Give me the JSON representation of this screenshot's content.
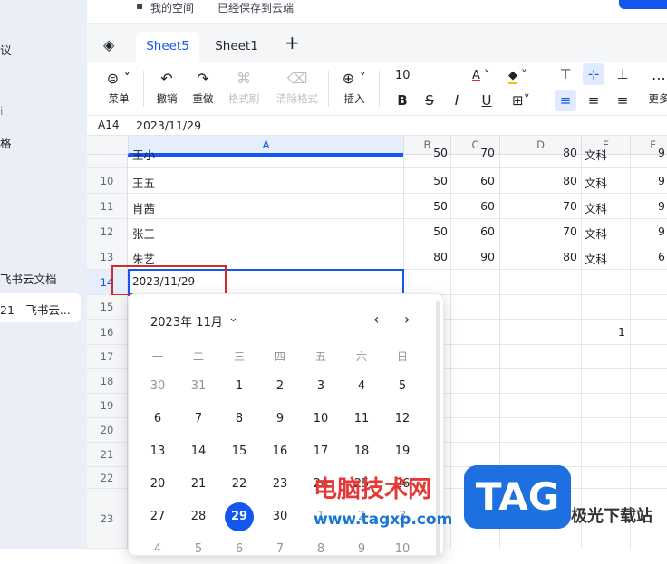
{
  "sidebar": {
    "items": [
      "议",
      "格",
      "飞书云文档",
      "21 - 飞书云..."
    ]
  },
  "topbar": {
    "space": "我的空间",
    "save_status": "已经保存到云端"
  },
  "tabs": [
    "Sheet5",
    "Sheet1"
  ],
  "add_sheet": "+",
  "toolbar": {
    "menu": "菜单",
    "undo": "撤销",
    "redo": "重做",
    "format_painter": "格式刷",
    "clear_format": "清除格式",
    "insert": "插入",
    "font_size": "10",
    "more": "更多"
  },
  "formula_bar": {
    "cell_ref": "A14",
    "value": "2023/11/29"
  },
  "columns": [
    "A",
    "B",
    "C",
    "D",
    "E",
    "F"
  ],
  "rows": [
    {
      "n": "10",
      "a": "王五",
      "b": "50",
      "c": "60",
      "d": "80",
      "e": "文科",
      "f": "9"
    },
    {
      "n": "11",
      "a": "肖茜",
      "b": "50",
      "c": "60",
      "d": "70",
      "e": "文科",
      "f": "9"
    },
    {
      "n": "12",
      "a": "张三",
      "b": "50",
      "c": "60",
      "d": "70",
      "e": "文科",
      "f": "9"
    },
    {
      "n": "13",
      "a": "朱艺",
      "b": "80",
      "c": "90",
      "d": "80",
      "e": "文科",
      "f": "6"
    }
  ],
  "partial_row": {
    "a": "王小",
    "b": "50",
    "c": "70",
    "d": "80",
    "e": "文科",
    "f": "9"
  },
  "active_cell": {
    "row": "14",
    "value": "2023/11/29"
  },
  "empty_rows": [
    "15",
    "16",
    "17",
    "18",
    "19",
    "20",
    "21",
    "22",
    "23"
  ],
  "cell_d16": "1",
  "calendar": {
    "month_label": "2023年 11月",
    "weekdays": [
      "一",
      "二",
      "三",
      "四",
      "五",
      "六",
      "日"
    ],
    "weeks": [
      [
        "30",
        "31",
        "1",
        "2",
        "3",
        "4",
        "5"
      ],
      [
        "6",
        "7",
        "8",
        "9",
        "10",
        "11",
        "12"
      ],
      [
        "13",
        "14",
        "15",
        "16",
        "17",
        "18",
        "19"
      ],
      [
        "20",
        "21",
        "22",
        "23",
        "24",
        "25",
        "26"
      ],
      [
        "27",
        "28",
        "29",
        "30",
        "1",
        "2",
        "3"
      ],
      [
        "4",
        "5",
        "6",
        "7",
        "8",
        "9",
        "10"
      ]
    ],
    "selected": "29"
  },
  "watermark": {
    "text": "电脑技术网",
    "url": "www.tagxp.com",
    "logo": "TAG",
    "site": "极光下载站"
  },
  "colors": {
    "accent": "#1456f0",
    "highlight_box": "#d62b2b"
  }
}
